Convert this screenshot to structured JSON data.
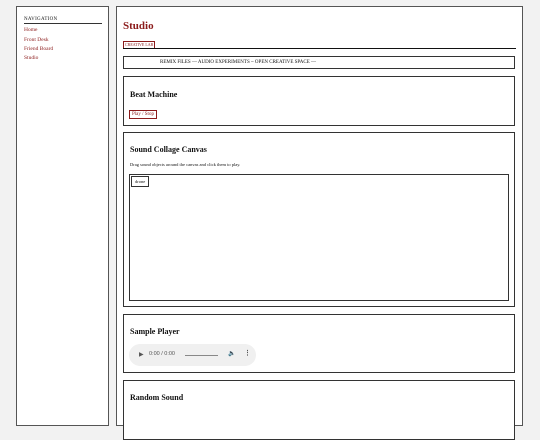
{
  "sidebar": {
    "heading": "NAVIGATION",
    "items": [
      {
        "label": "Home"
      },
      {
        "label": "Front Desk"
      },
      {
        "label": "Friend Board"
      },
      {
        "label": "Studio"
      }
    ]
  },
  "main": {
    "title": "Studio",
    "badge": "CREATIVE LAB",
    "marquee": "REMIX FILES — AUDIO EXPERIMENTS ~ OPEN CREATIVE SPACE —"
  },
  "beat_machine": {
    "title": "Beat Machine",
    "button_label": "Play / Stop"
  },
  "collage": {
    "title": "Sound Collage Canvas",
    "description": "Drag sound objects around the canvas and click them to play.",
    "objects": [
      {
        "label": "drone"
      }
    ]
  },
  "sample_player": {
    "title": "Sample Player",
    "time": "0:00 / 0:00"
  },
  "random_sound": {
    "title": "Random Sound"
  },
  "colors": {
    "accent": "#8b1a1a",
    "background": "#f2f2f2",
    "panel": "#ffffff"
  }
}
